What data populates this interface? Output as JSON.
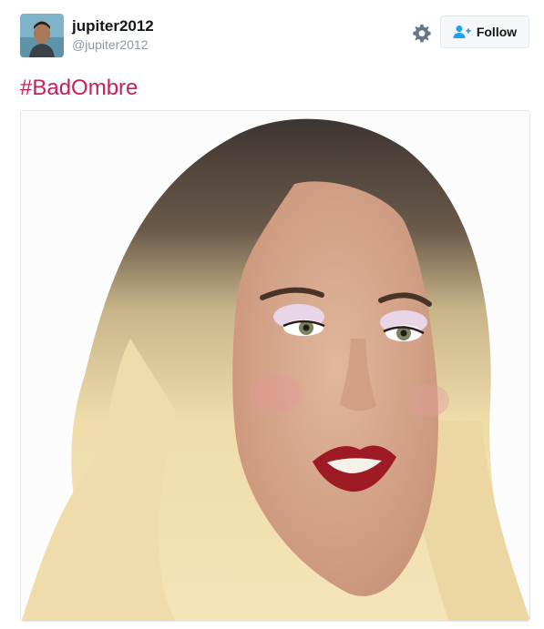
{
  "user": {
    "display_name": "jupiter2012",
    "handle": "@jupiter2012"
  },
  "actions": {
    "settings_icon": "gear-icon",
    "follow_icon": "add-user-icon",
    "follow_label": "Follow"
  },
  "tweet": {
    "text": "#BadOmbre"
  },
  "colors": {
    "hashtag": "#c51f5d",
    "follow_icon": "#1da1f2",
    "border": "#e1e8ed"
  }
}
